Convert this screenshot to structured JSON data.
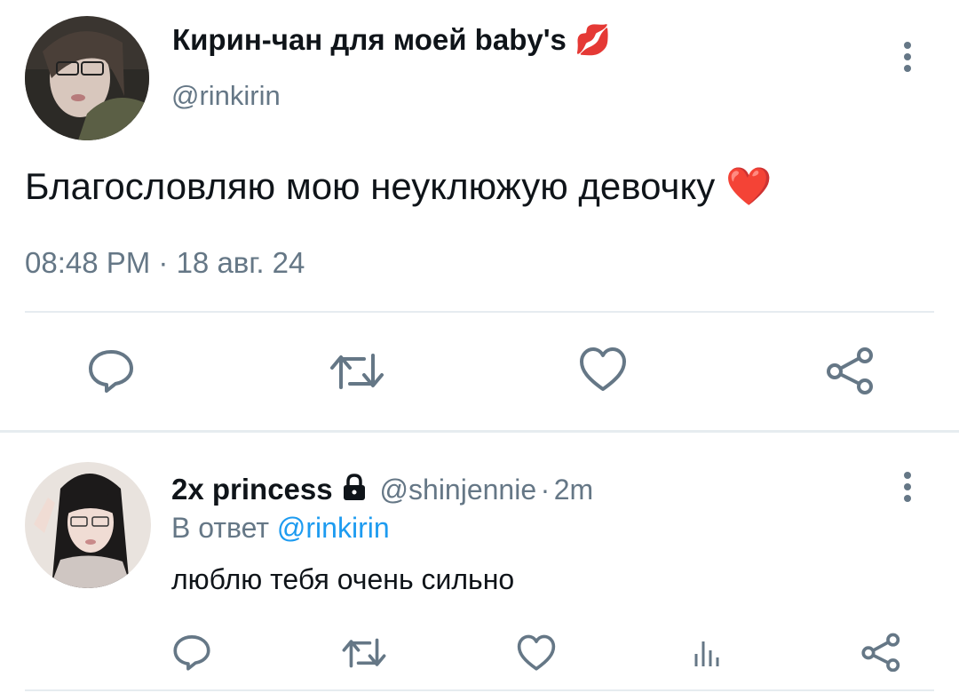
{
  "main_tweet": {
    "display_name": "Кирин-чан для моей baby's",
    "name_emoji": "💋",
    "handle": "@rinkirin",
    "text": "Благословляю мою неуклюжую девочку",
    "text_emoji": "❤️",
    "timestamp": "08:48 PM · 18 авг. 24",
    "actions": [
      "reply-icon",
      "retweet-icon",
      "like-icon",
      "share-icon"
    ]
  },
  "reply": {
    "display_name": "2x princess",
    "badge_icon": "lock-icon",
    "handle": "@shinjennie",
    "separator": "·",
    "time": "2m",
    "reply_to_prefix": "В ответ",
    "reply_to_handle": "@rinkirin",
    "text": "люблю тебя очень сильно",
    "actions": [
      "reply-icon",
      "retweet-icon",
      "like-icon",
      "analytics-icon",
      "share-icon"
    ]
  },
  "colors": {
    "text": "#0f1419",
    "muted": "#657786",
    "link": "#1d9bf0",
    "icon": "#657786",
    "divider": "#e6ecf0",
    "heart": "#e8594a",
    "lips": "#e24b4b"
  }
}
